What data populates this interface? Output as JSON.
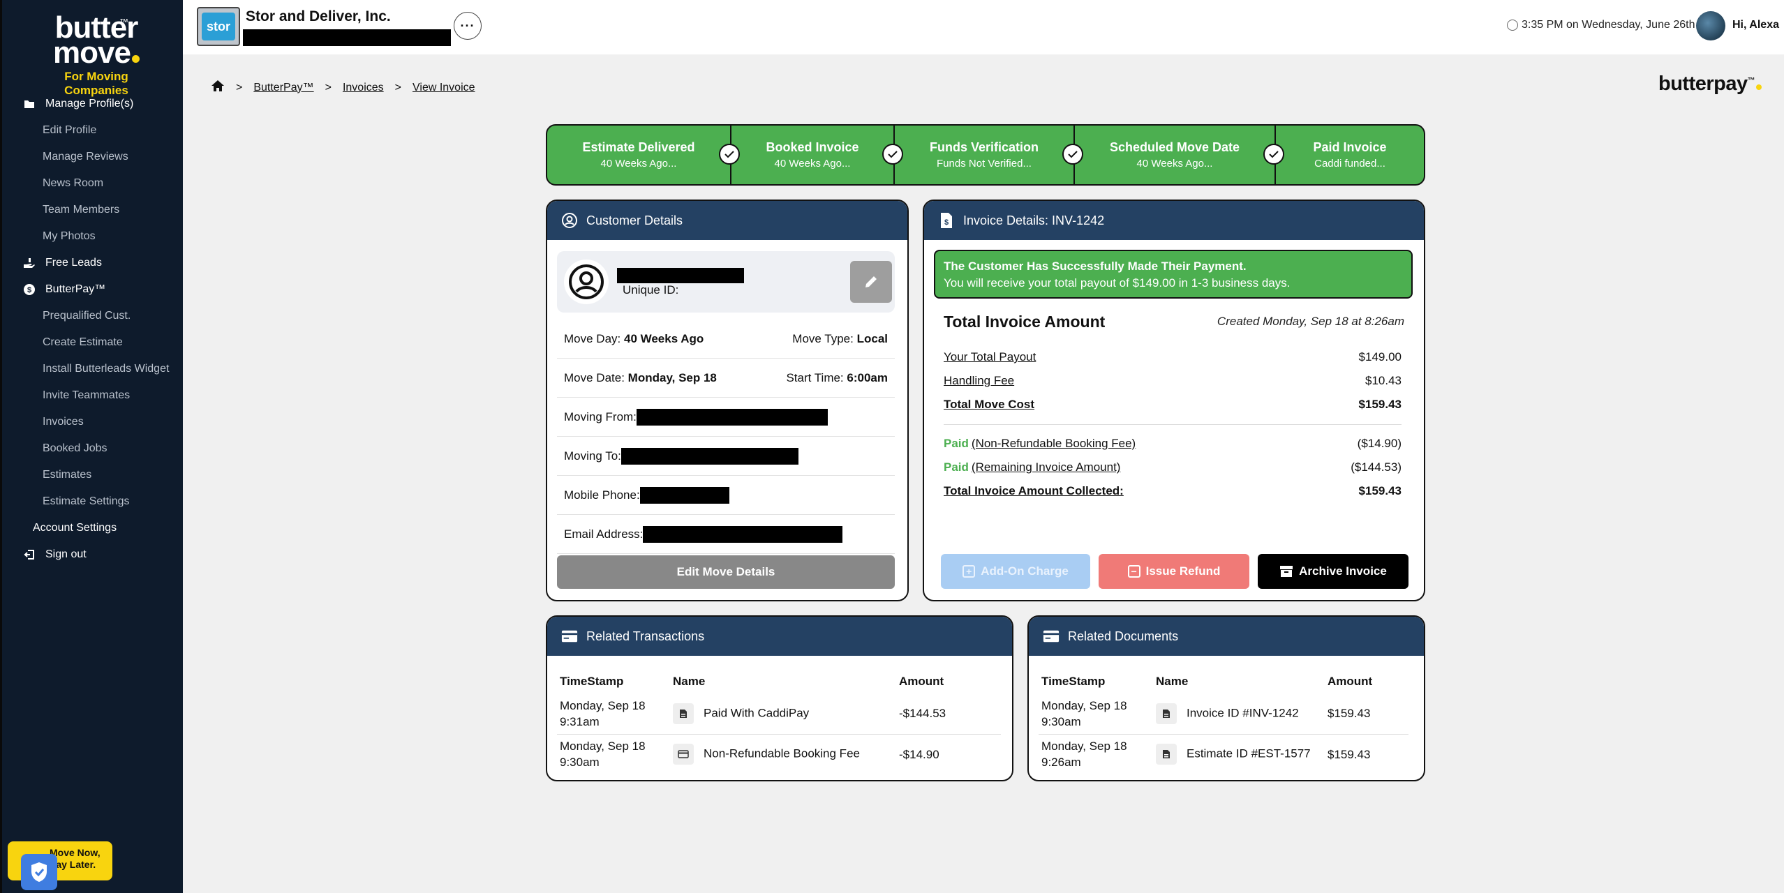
{
  "sidebar": {
    "logo": {
      "line1": "butter",
      "line2": "move",
      "tm": "™",
      "tagline": "For Moving Companies"
    },
    "items": [
      {
        "label": "Manage Profile(s)",
        "type": "top",
        "icon": "folder-icon"
      },
      {
        "label": "Edit Profile",
        "type": "sub"
      },
      {
        "label": "Manage Reviews",
        "type": "sub"
      },
      {
        "label": "News Room",
        "type": "sub"
      },
      {
        "label": "Team Members",
        "type": "sub"
      },
      {
        "label": "My Photos",
        "type": "sub"
      },
      {
        "label": "Free Leads",
        "type": "top",
        "icon": "hand-icon"
      },
      {
        "label": "ButterPay™",
        "type": "top",
        "icon": "dollar-circle-icon"
      },
      {
        "label": "Prequalified Cust.",
        "type": "sub"
      },
      {
        "label": "Create Estimate",
        "type": "sub"
      },
      {
        "label": "Install Butterleads Widget",
        "type": "sub"
      },
      {
        "label": "Invite Teammates",
        "type": "sub"
      },
      {
        "label": "Invoices",
        "type": "sub"
      },
      {
        "label": "Booked Jobs",
        "type": "sub"
      },
      {
        "label": "Estimates",
        "type": "sub"
      },
      {
        "label": "Estimate Settings",
        "type": "sub"
      },
      {
        "label": "Account Settings",
        "type": "plain"
      },
      {
        "label": "Sign out",
        "type": "top",
        "icon": "sign-out-icon"
      }
    ],
    "promo": {
      "line1": "Move Now,",
      "line2": "Pay Later."
    }
  },
  "topbar": {
    "company_logo_text": "stor",
    "company_name": "Stor and Deliver, Inc.",
    "datetime": "3:35 PM on Wednesday, June 26th",
    "greeting": "Hi, Alexa"
  },
  "breadcrumb": {
    "items": [
      "ButterPay™",
      "Invoices",
      "View Invoice"
    ]
  },
  "brand": {
    "butterpay": "butterpay",
    "tm": "™"
  },
  "stepper": [
    {
      "title": "Estimate Delivered",
      "sub": "40 Weeks Ago..."
    },
    {
      "title": "Booked Invoice",
      "sub": "40 Weeks Ago..."
    },
    {
      "title": "Funds Verification",
      "sub": "Funds Not Verified..."
    },
    {
      "title": "Scheduled Move Date",
      "sub": "40 Weeks Ago..."
    },
    {
      "title": "Paid Invoice",
      "sub": "Caddi funded..."
    }
  ],
  "customer": {
    "header": "Customer Details",
    "unique_id_label": "Unique ID:",
    "move_day_label": "Move Day:",
    "move_day": "40 Weeks Ago",
    "move_type_label": "Move Type:",
    "move_type": "Local",
    "move_date_label": "Move Date:",
    "move_date": "Monday, Sep 18",
    "start_time_label": "Start Time:",
    "start_time": "6:00am",
    "moving_from_label": "Moving From:",
    "moving_to_label": "Moving To:",
    "mobile_label": "Mobile Phone:",
    "email_label": "Email Address:",
    "edit_move_button": "Edit Move Details"
  },
  "invoice": {
    "header": "Invoice Details: INV-1242",
    "success_title": "The Customer Has Successfully Made Their Payment.",
    "success_text": "You will receive your total payout of $149.00 in 1-3 business days.",
    "title": "Total Invoice Amount",
    "created": "Created Monday, Sep 18 at 8:26am",
    "lines": [
      {
        "label": "Your Total Payout",
        "value": "$149.00"
      },
      {
        "label": "Handling Fee",
        "value": "$10.43"
      },
      {
        "label": "Total Move Cost",
        "value": "$159.43"
      }
    ],
    "paid_word": "Paid",
    "paid_lines": [
      {
        "label": "(Non-Refundable Booking Fee)",
        "value": "($14.90)"
      },
      {
        "label": "(Remaining Invoice Amount)",
        "value": "($144.53)"
      }
    ],
    "collected_label": "Total Invoice Amount Collected:",
    "collected_value": "$159.43",
    "buttons": {
      "addon": "Add-On Charge",
      "refund": "Issue Refund",
      "archive": "Archive Invoice"
    }
  },
  "transactions": {
    "header": "Related Transactions",
    "columns": [
      "TimeStamp",
      "Name",
      "Amount"
    ],
    "rows": [
      {
        "date": "Monday, Sep 18",
        "time": "9:31am",
        "name": "Paid With CaddiPay",
        "amount": "-$144.53"
      },
      {
        "date": "Monday, Sep 18",
        "time": "9:30am",
        "name": "Non-Refundable Booking Fee",
        "amount": "-$14.90"
      }
    ]
  },
  "documents": {
    "header": "Related Documents",
    "columns": [
      "TimeStamp",
      "Name",
      "Amount"
    ],
    "rows": [
      {
        "date": "Monday, Sep 18",
        "time": "9:30am",
        "name": "Invoice ID #INV-1242",
        "amount": "$159.43"
      },
      {
        "date": "Monday, Sep 18",
        "time": "9:26am",
        "name": "Estimate ID #EST-1577",
        "amount": "$159.43"
      }
    ]
  }
}
